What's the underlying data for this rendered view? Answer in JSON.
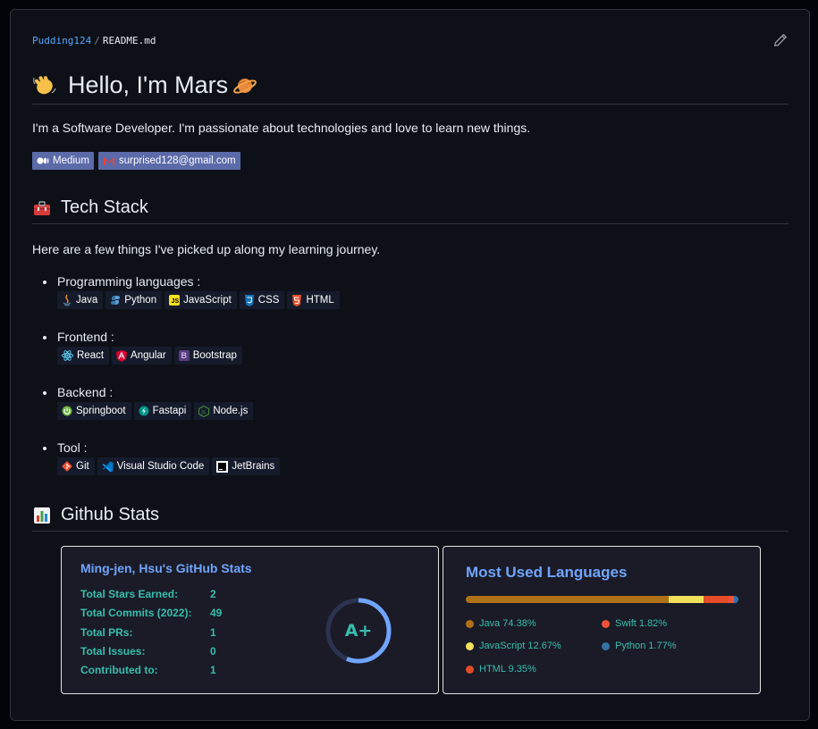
{
  "breadcrumb": {
    "owner": "Pudding124",
    "separator": "/",
    "file": "README.md"
  },
  "readme": {
    "title": "Hello, I'm Mars",
    "intro": "I'm a Software Developer. I'm passionate about technologies and love to learn new things.",
    "contacts": [
      {
        "label": "Medium",
        "icon": "medium-icon"
      },
      {
        "label": "surprised128@gmail.com",
        "icon": "gmail-icon"
      }
    ],
    "tech_stack": {
      "heading": "Tech Stack",
      "intro": "Here are a few things I've picked up along my learning journey.",
      "categories": [
        {
          "label": "Programming languages :",
          "items": [
            "Java",
            "Python",
            "JavaScript",
            "CSS",
            "HTML"
          ]
        },
        {
          "label": "Frontend :",
          "items": [
            "React",
            "Angular",
            "Bootstrap"
          ]
        },
        {
          "label": "Backend :",
          "items": [
            "Springboot",
            "Fastapi",
            "Node.js"
          ]
        },
        {
          "label": "Tool :",
          "items": [
            "Git",
            "Visual Studio Code",
            "JetBrains"
          ]
        }
      ]
    },
    "github_stats": {
      "heading": "Github Stats"
    }
  },
  "stats_card": {
    "title": "Ming-jen, Hsu's GitHub Stats",
    "rows": [
      {
        "label": "Total Stars Earned:",
        "value": "2"
      },
      {
        "label": "Total Commits (2022):",
        "value": "49"
      },
      {
        "label": "Total PRs:",
        "value": "1"
      },
      {
        "label": "Total Issues:",
        "value": "0"
      },
      {
        "label": "Contributed to:",
        "value": "1"
      }
    ],
    "grade": "A+"
  },
  "lang_card": {
    "title": "Most Used Languages",
    "languages": [
      {
        "name": "Java",
        "percent": 74.38,
        "label": "Java 74.38%",
        "color": "#b07219"
      },
      {
        "name": "JavaScript",
        "percent": 12.67,
        "label": "JavaScript 12.67%",
        "color": "#f1e05a"
      },
      {
        "name": "HTML",
        "percent": 9.35,
        "label": "HTML 9.35%",
        "color": "#e34c26"
      },
      {
        "name": "Swift",
        "percent": 1.82,
        "label": "Swift 1.82%",
        "color": "#f05138"
      },
      {
        "name": "Python",
        "percent": 1.77,
        "label": "Python 1.77%",
        "color": "#3572a5"
      }
    ]
  }
}
